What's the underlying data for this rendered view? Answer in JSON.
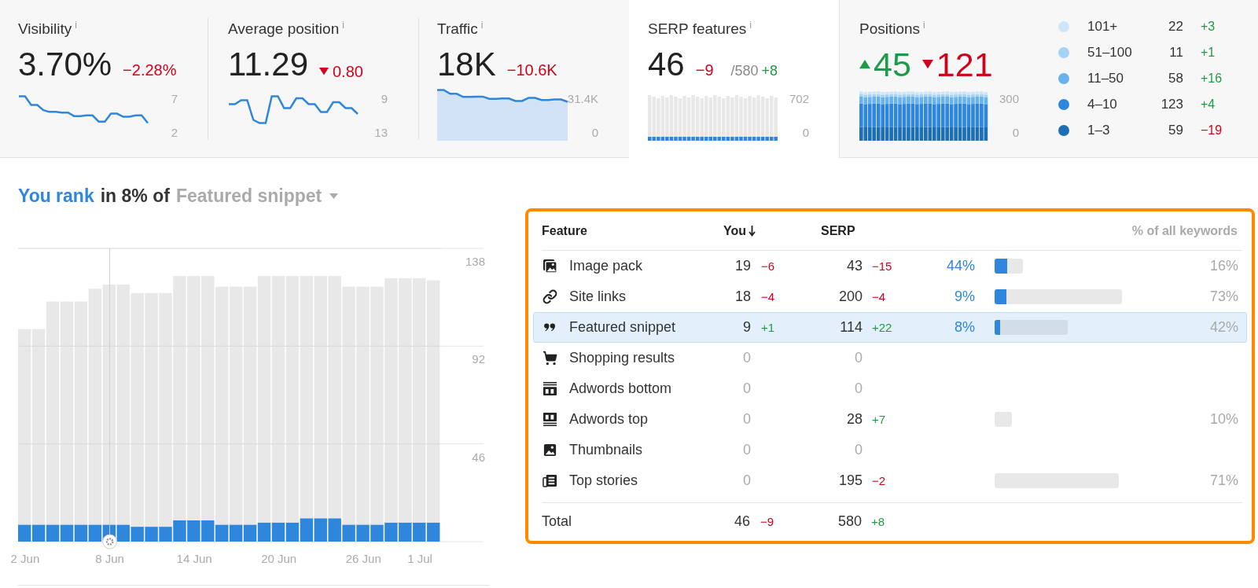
{
  "summary": {
    "cards": [
      {
        "kind": "line",
        "title": "Visibility",
        "info": "i",
        "selected": false,
        "value": "3.70%",
        "change": {
          "text": "−2.28%",
          "negative": true,
          "arrow": false
        },
        "axis": [
          "7",
          "2"
        ]
      },
      {
        "kind": "line",
        "title": "Average position",
        "info": "i",
        "selected": false,
        "value": "11.29",
        "change": {
          "text": "0.80",
          "negative": true,
          "arrow": true
        },
        "axis": [
          "9",
          "13"
        ]
      },
      {
        "kind": "area",
        "title": "Traffic",
        "info": "i",
        "selected": false,
        "value": "18K",
        "change": {
          "text": "−10.6K",
          "negative": true,
          "arrow": false
        },
        "axis": [
          "31.4K",
          "0"
        ]
      },
      {
        "kind": "bars",
        "title": "SERP features",
        "info": "i",
        "selected": true,
        "value": "46",
        "change": {
          "text": "−9",
          "negative": true,
          "arrow": false
        },
        "total": "/580",
        "total_change": {
          "text": "+8",
          "negative": false,
          "arrow": false
        },
        "axis": [
          "702",
          "0"
        ]
      },
      {
        "kind": "stacked",
        "title": "Positions",
        "info": "i",
        "selected": false,
        "movers": [
          {
            "text": "45",
            "negative": false,
            "arrow": true
          },
          {
            "text": "121",
            "negative": true,
            "arrow": true
          }
        ],
        "axis": [
          "300",
          "0"
        ],
        "legend": [
          {
            "label": "101+",
            "count": "22",
            "change": {
              "text": "+3",
              "negative": false
            },
            "color": "#cfe6fa"
          },
          {
            "label": "51–100",
            "count": "11",
            "change": {
              "text": "+1",
              "negative": false
            },
            "color": "#a6d2f5"
          },
          {
            "label": "11–50",
            "count": "58",
            "change": {
              "text": "+16",
              "negative": false
            },
            "color": "#68b3ee"
          },
          {
            "label": "4–10",
            "count": "123",
            "change": {
              "text": "+4",
              "negative": false
            },
            "color": "#2f86dd"
          },
          {
            "label": "1–3",
            "count": "59",
            "change": {
              "text": "−19",
              "negative": true
            },
            "color": "#1d6fb4"
          }
        ]
      }
    ]
  },
  "heading": {
    "lead": "You rank",
    "middle": "in 8% of",
    "dropdown": "Featured snippet"
  },
  "chart": {
    "chart_data": {
      "type": "bar",
      "stacked": true,
      "grid": true,
      "ylim": [
        0,
        138
      ],
      "yticks": [
        46,
        92,
        138
      ],
      "categories": [
        "2 Jun",
        null,
        null,
        null,
        null,
        null,
        "8 Jun",
        null,
        null,
        null,
        null,
        null,
        "14 Jun",
        null,
        null,
        null,
        null,
        null,
        "20 Jun",
        null,
        null,
        null,
        null,
        null,
        "26 Jun",
        null,
        null,
        null,
        "1 Jul",
        null
      ],
      "series": [
        {
          "color": "#2f86dd",
          "values": [
            8,
            8,
            8,
            8,
            8,
            8,
            8,
            8,
            7,
            7,
            7,
            10,
            10,
            10,
            8,
            8,
            8,
            9,
            9,
            9,
            11,
            11,
            11,
            8,
            8,
            8,
            9,
            9,
            9,
            9
          ]
        },
        {
          "color": "#e8e8e8",
          "values": [
            92,
            92,
            105,
            105,
            105,
            111,
            113,
            113,
            110,
            110,
            110,
            115,
            115,
            115,
            112,
            112,
            112,
            116,
            116,
            116,
            114,
            114,
            114,
            112,
            112,
            112,
            115,
            115,
            115,
            114
          ]
        }
      ]
    }
  },
  "table": {
    "columns": {
      "feature": "Feature",
      "you": "You",
      "serp": "SERP",
      "share": "% of all keywords"
    },
    "rows": [
      {
        "kind": "image-pack",
        "name": "Image pack",
        "selected": false,
        "you": {
          "value": "19",
          "dim": false,
          "change": "−6",
          "negative": true
        },
        "serp": {
          "value": "43",
          "dim": false,
          "change": "−15",
          "negative": true
        },
        "share": "44%",
        "bar": {
          "level": 0.16,
          "fill": {
            "level": 0.44
          }
        },
        "pct": "16%"
      },
      {
        "kind": "link",
        "name": "Site links",
        "selected": false,
        "you": {
          "value": "18",
          "dim": false,
          "change": "−4",
          "negative": true
        },
        "serp": {
          "value": "200",
          "dim": false,
          "change": "−4",
          "negative": true
        },
        "share": "9%",
        "bar": {
          "level": 0.73,
          "fill": {
            "level": 0.09
          }
        },
        "pct": "73%"
      },
      {
        "kind": "quote",
        "name": "Featured snippet",
        "selected": true,
        "you": {
          "value": "9",
          "dim": false,
          "change": "+1",
          "negative": false
        },
        "serp": {
          "value": "114",
          "dim": false,
          "change": "+22",
          "negative": false
        },
        "share": "8%",
        "bar": {
          "level": 0.42,
          "fill": {
            "level": 0.08
          }
        },
        "pct": "42%"
      },
      {
        "kind": "cart",
        "name": "Shopping results",
        "selected": false,
        "you": {
          "value": "0",
          "dim": true
        },
        "serp": {
          "value": "0",
          "dim": true
        }
      },
      {
        "kind": "ad-bottom",
        "name": "Adwords bottom",
        "selected": false,
        "you": {
          "value": "0",
          "dim": true
        },
        "serp": {
          "value": "0",
          "dim": true
        }
      },
      {
        "kind": "ad-top",
        "name": "Adwords top",
        "selected": false,
        "you": {
          "value": "0",
          "dim": true
        },
        "serp": {
          "value": "28",
          "dim": false,
          "change": "+7",
          "negative": false
        },
        "bar": {
          "level": 0.1
        },
        "pct": "10%"
      },
      {
        "kind": "thumbnail",
        "name": "Thumbnails",
        "selected": false,
        "you": {
          "value": "0",
          "dim": true
        },
        "serp": {
          "value": "0",
          "dim": true
        }
      },
      {
        "kind": "news",
        "name": "Top stories",
        "selected": false,
        "you": {
          "value": "0",
          "dim": true
        },
        "serp": {
          "value": "195",
          "dim": false,
          "change": "−2",
          "negative": true
        },
        "bar": {
          "level": 0.71
        },
        "pct": "71%"
      }
    ],
    "total": {
      "label": "Total",
      "you": {
        "value": "46",
        "dim": false,
        "change": "−9",
        "negative": true
      },
      "serp": {
        "value": "580",
        "dim": false,
        "change": "+8",
        "negative": false
      }
    }
  }
}
